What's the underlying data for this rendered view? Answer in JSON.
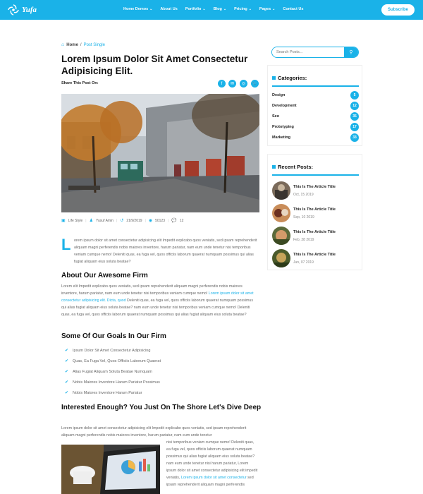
{
  "brand": {
    "name": "Yufa"
  },
  "nav": {
    "items": [
      "Home Demos",
      "About Us",
      "Portfolio",
      "Blog",
      "Pricing",
      "Pages",
      "Contact Us"
    ],
    "subscribe": "Subscribe"
  },
  "breadcrumb": {
    "home": "Home",
    "sep": "/",
    "current": "Post Single"
  },
  "post": {
    "title": "Lorem Ipsum Dolor Sit Amet Consectetur Adipisicing Elit.",
    "share_label": "Share This Post On:",
    "share_icons": [
      "facebook-icon",
      "email-icon",
      "instagram-icon",
      "twitter-icon"
    ],
    "meta": {
      "category": "Life Style",
      "author": "Yusuf Amin",
      "date": "21/9/2019",
      "views": "50123",
      "comments": "12"
    },
    "dropcap": "L",
    "intro": "orem ipsum dolor sit amet consectetur adipisicing elit Impedit explicabo quos veniatis, sed ipsam reprehenderit aliquam magni perferendis nobis maiores inventore, harum pariatur, nam eum unde tenetur nisi temporibus veniam cumque nemo! Deleniti quas, ea fuga vel, quos officiis laborum quaerat numquam possimus qui alias fugiat aliquam eius soluta beatae?",
    "section1": {
      "heading": "About Our Awesome Firm",
      "text_a": "Lorem elit Impedit explicabo quos veniatis, sed ipsam reprehenderit aliquam magni perferendis nobis maiores inventore, harum pariatur, nam eum unde tenetur nisi temporibus veniam cumque nemo! ",
      "link": "Lorem ipsum dolor sit amet consectetur adipisicing elit. Dicta, quod",
      "text_b": " Deleniti quas, ea fuga vel, quos officiis laborum quaerat numquam possimus qui alias fugiat aliquam eius soluta beatae? nam eum unde tenetur nisi temporibus veniam cumque nemo! Deleniti quas, ea fuga vel, quos officiis laborum quaerat numquam possimus qui alias fugiat aliquam eius soluta beatae?"
    },
    "section2": {
      "heading": "Some Of Our Goals In Our Firm",
      "bullets": [
        "Ipsum Dolor Sit Amet Consectetur Adipisicing",
        "Quas, Ea Fuga Vel, Quos Officiis Laborum Quaerat",
        "Alias Fugiat Aliquam Soluta Beatae Numquam",
        "Nobis Maiores Inventore Harum Pariatur Possimus",
        "Nobis Maiores Inventore Harum Pariatur"
      ]
    },
    "section3": {
      "heading": "Interested Enough? You Just On The Shore Let's Dive Deep",
      "text_full": "Lorem ipsum dolor sit amet consectetur adipisicing elit Impedit explicabo quos veniatis, sed ipsam reprehenderit aliquam magni perferendis nobis maiores inventore, harum pariatur, nam eum unde tenetur",
      "text_side_a": "nisi temporibus veniam cumque nemo! Deleniti quas, ea fuga vel, quos officiis laborum quaerat numquam possimus qui alias fugiat aliquam eius soluta beatae? nam eum unde tenetur nisi harum pariatur, Lorem ipsum dolor sit amet consectetur adipisicing elit impedit veniatis,",
      "link": "Lorem ipsum dolor sit amet consectetur",
      "text_side_b": " sed ipsam reprehenderit aliquam magni perferendis"
    }
  },
  "sidebar": {
    "search_placeholder": "Search Posts...",
    "categories_title": "Categories:",
    "categories": [
      {
        "name": "Design",
        "count": "5"
      },
      {
        "name": "Development",
        "count": "12"
      },
      {
        "name": "Seo",
        "count": "35"
      },
      {
        "name": "Prototyping",
        "count": "17"
      },
      {
        "name": "Marketing",
        "count": "33"
      }
    ],
    "recent_title": "Recent Posts:",
    "recent": [
      {
        "title": "This Is The Article Title",
        "date": "Oct, 15 2019"
      },
      {
        "title": "This Is The Article Title",
        "date": "Sep, 10 2019"
      },
      {
        "title": "This Is The Article Title",
        "date": "Feb, 28 2019"
      },
      {
        "title": "This Is The Article Title",
        "date": "Jun, 07 2019"
      }
    ]
  },
  "colors": {
    "accent": "#1ab2e8",
    "heading": "#111111",
    "body": "#666666"
  }
}
